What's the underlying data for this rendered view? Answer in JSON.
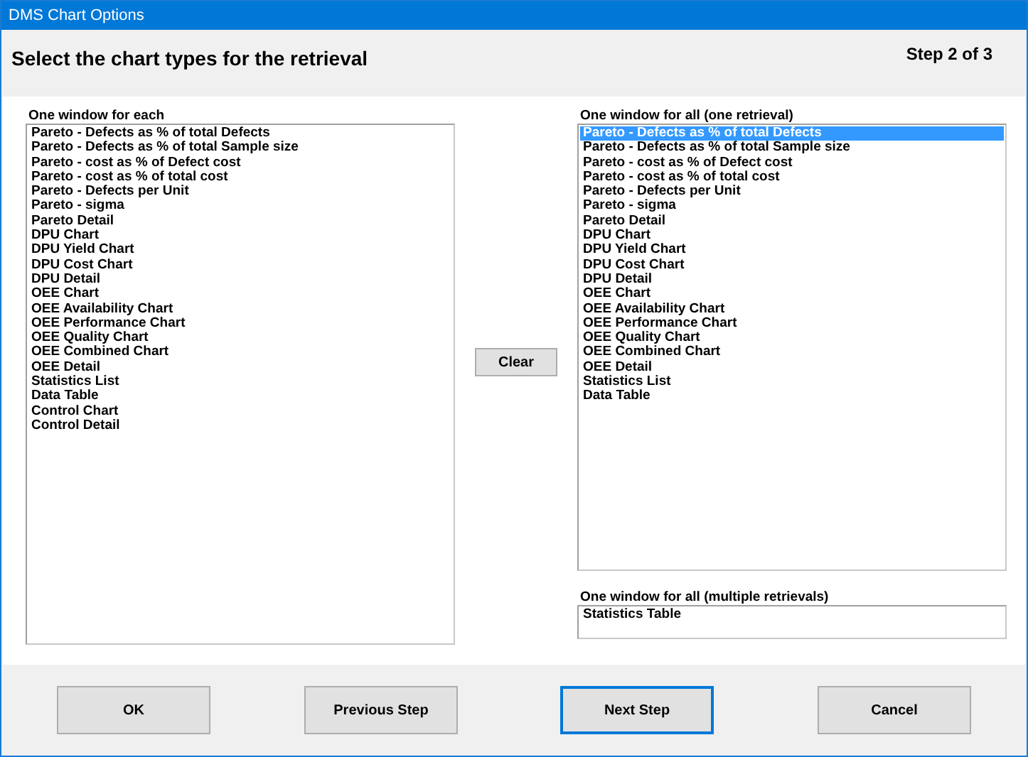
{
  "window": {
    "title": "DMS Chart Options"
  },
  "header": {
    "heading": "Select the chart types for the retrieval",
    "step": "Step 2 of 3"
  },
  "left_list": {
    "label": "One window for each",
    "items": [
      {
        "text": "Pareto - Defects as % of total Defects",
        "selected": false
      },
      {
        "text": "Pareto - Defects as % of total Sample size",
        "selected": false
      },
      {
        "text": "Pareto - cost as % of Defect cost",
        "selected": false
      },
      {
        "text": "Pareto - cost as % of total cost",
        "selected": false
      },
      {
        "text": "Pareto - Defects per Unit",
        "selected": false
      },
      {
        "text": "Pareto - sigma",
        "selected": false
      },
      {
        "text": "Pareto Detail",
        "selected": false
      },
      {
        "text": "DPU Chart",
        "selected": false
      },
      {
        "text": "DPU Yield Chart",
        "selected": false
      },
      {
        "text": "DPU Cost Chart",
        "selected": false
      },
      {
        "text": "DPU Detail",
        "selected": false
      },
      {
        "text": "OEE Chart",
        "selected": false
      },
      {
        "text": "OEE Availability Chart",
        "selected": false
      },
      {
        "text": "OEE Performance Chart",
        "selected": false
      },
      {
        "text": "OEE Quality Chart",
        "selected": false
      },
      {
        "text": "OEE Combined Chart",
        "selected": false
      },
      {
        "text": "OEE Detail",
        "selected": false
      },
      {
        "text": "Statistics List",
        "selected": false
      },
      {
        "text": "Data Table",
        "selected": false
      },
      {
        "text": "Control Chart",
        "selected": false
      },
      {
        "text": "Control Detail",
        "selected": false
      }
    ]
  },
  "clear_button": "Clear",
  "right_list": {
    "label": "One window for all (one retrieval)",
    "items": [
      {
        "text": "Pareto - Defects as % of total Defects",
        "selected": true
      },
      {
        "text": "Pareto - Defects as % of total Sample size",
        "selected": false
      },
      {
        "text": "Pareto - cost as % of Defect cost",
        "selected": false
      },
      {
        "text": "Pareto - cost as % of total cost",
        "selected": false
      },
      {
        "text": "Pareto - Defects per Unit",
        "selected": false
      },
      {
        "text": "Pareto - sigma",
        "selected": false
      },
      {
        "text": "Pareto Detail",
        "selected": false
      },
      {
        "text": "DPU Chart",
        "selected": false
      },
      {
        "text": "DPU Yield Chart",
        "selected": false
      },
      {
        "text": "DPU Cost Chart",
        "selected": false
      },
      {
        "text": "DPU Detail",
        "selected": false
      },
      {
        "text": "OEE Chart",
        "selected": false
      },
      {
        "text": "OEE Availability Chart",
        "selected": false
      },
      {
        "text": "OEE Performance Chart",
        "selected": false
      },
      {
        "text": "OEE Quality Chart",
        "selected": false
      },
      {
        "text": "OEE Combined Chart",
        "selected": false
      },
      {
        "text": "OEE Detail",
        "selected": false
      },
      {
        "text": "Statistics List",
        "selected": false
      },
      {
        "text": "Data Table",
        "selected": false
      }
    ]
  },
  "multi_list": {
    "label": "One window for all (multiple retrievals)",
    "items": [
      {
        "text": "Statistics Table",
        "selected": false
      }
    ]
  },
  "buttons": [
    {
      "label": "OK",
      "default": false
    },
    {
      "label": "Previous Step",
      "default": false
    },
    {
      "label": "Next Step",
      "default": true
    },
    {
      "label": "Cancel",
      "default": false
    }
  ]
}
